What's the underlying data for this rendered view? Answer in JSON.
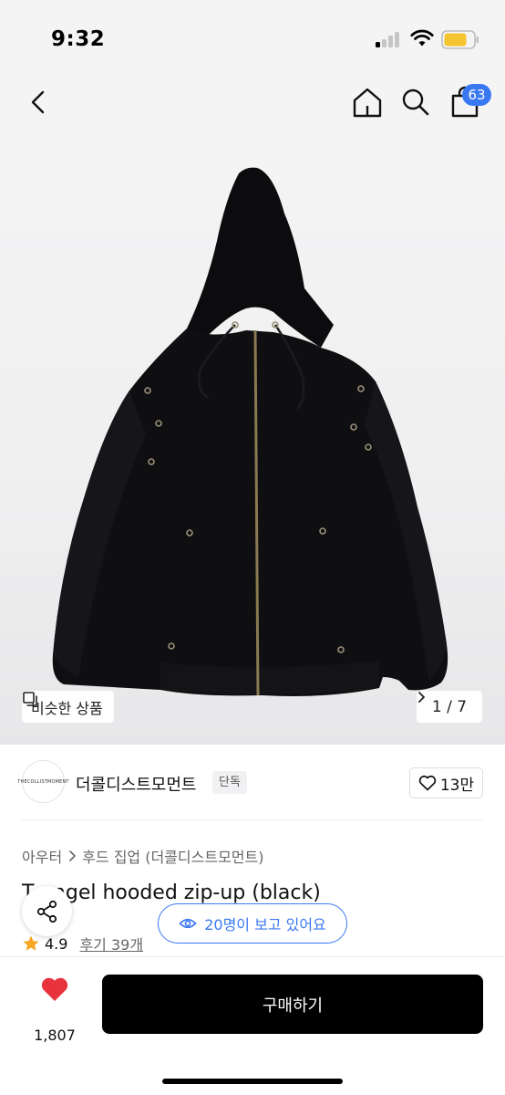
{
  "status_bar": {
    "time": "9:32"
  },
  "header": {
    "cart_count": "63"
  },
  "gallery": {
    "similar_label": "비슷한 상품",
    "page_indicator": "1 / 7"
  },
  "brand": {
    "logo_text": "THECOLLISTMOMENT",
    "name": "더콜디스트모먼트",
    "badge": "단독",
    "like_count": "13만"
  },
  "breadcrumb": {
    "items": [
      "아우터",
      "후드 집업 (더콜디스트모먼트)"
    ]
  },
  "product": {
    "title": "T   angel hooded zip-up (black)",
    "rating": "4.9",
    "reviews_label": "후기 39개"
  },
  "floating": {
    "viewers_label": "20명이 보고 있어요"
  },
  "bottom_bar": {
    "wish_count": "1,807",
    "buy_label": "구매하기"
  },
  "colors": {
    "accent_blue": "#3a78f2",
    "heart_red": "#e8323c",
    "star": "#f5a623",
    "buy_button": "#000000"
  }
}
